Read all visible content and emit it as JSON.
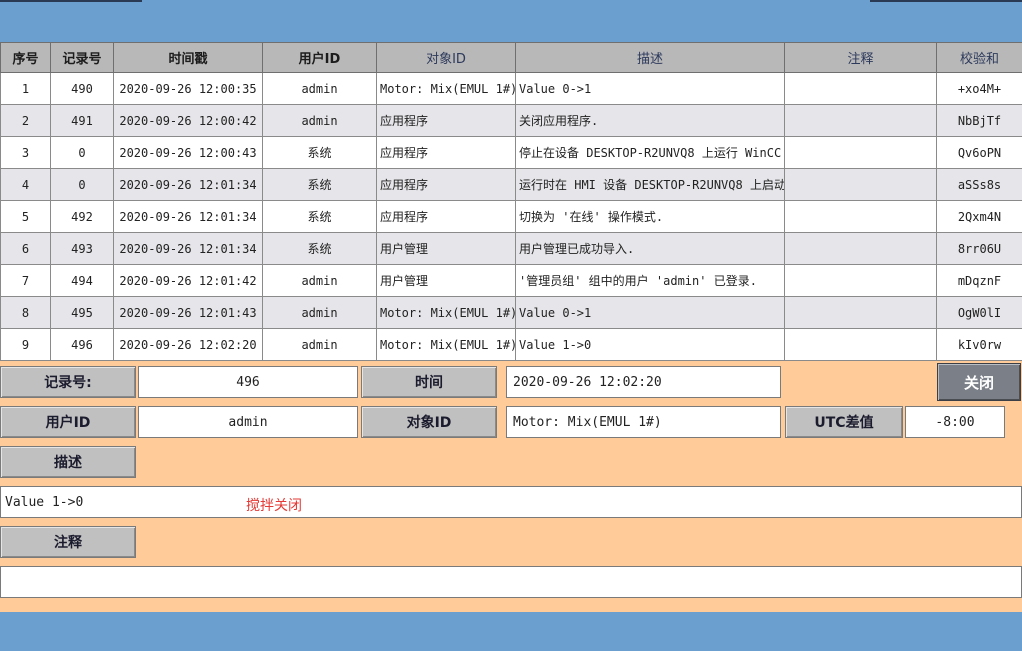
{
  "table": {
    "headers": [
      "序号",
      "记录号",
      "时间戳",
      "用户ID",
      "对象ID",
      "描述",
      "注释",
      "校验和"
    ],
    "rows": [
      {
        "seq": "1",
        "record": "490",
        "timestamp": "2020-09-26 12:00:35",
        "user": "admin",
        "object": "Motor: Mix(EMUL 1#)",
        "desc": "Value 0->1",
        "note": "",
        "checksum": "+xo4M+"
      },
      {
        "seq": "2",
        "record": "491",
        "timestamp": "2020-09-26 12:00:42",
        "user": "admin",
        "object": "应用程序",
        "desc": "关闭应用程序.",
        "note": "",
        "checksum": "NbBjTf"
      },
      {
        "seq": "3",
        "record": "0",
        "timestamp": "2020-09-26 12:00:43",
        "user": "系统",
        "object": "应用程序",
        "desc": "停止在设备 DESKTOP-R2UNVQ8 上运行 WinCC",
        "note": "",
        "checksum": "Qv6oPN"
      },
      {
        "seq": "4",
        "record": "0",
        "timestamp": "2020-09-26 12:01:34",
        "user": "系统",
        "object": "应用程序",
        "desc": "运行时在 HMI 设备 DESKTOP-R2UNVQ8 上启动",
        "note": "",
        "checksum": "aSSs8s"
      },
      {
        "seq": "5",
        "record": "492",
        "timestamp": "2020-09-26 12:01:34",
        "user": "系统",
        "object": "应用程序",
        "desc": "切换为 '在线' 操作模式.",
        "note": "",
        "checksum": "2Qxm4N"
      },
      {
        "seq": "6",
        "record": "493",
        "timestamp": "2020-09-26 12:01:34",
        "user": "系统",
        "object": "用户管理",
        "desc": "用户管理已成功导入.",
        "note": "",
        "checksum": "8rr06U"
      },
      {
        "seq": "7",
        "record": "494",
        "timestamp": "2020-09-26 12:01:42",
        "user": "admin",
        "object": "用户管理",
        "desc": "'管理员组' 组中的用户 'admin' 已登录.",
        "note": "",
        "checksum": "mDqznF"
      },
      {
        "seq": "8",
        "record": "495",
        "timestamp": "2020-09-26 12:01:43",
        "user": "admin",
        "object": "Motor: Mix(EMUL 1#)",
        "desc": "Value 0->1",
        "note": "",
        "checksum": "OgW0lI"
      },
      {
        "seq": "9",
        "record": "496",
        "timestamp": "2020-09-26 12:02:20",
        "user": "admin",
        "object": "Motor: Mix(EMUL 1#)",
        "desc": "Value 1->0",
        "note": "",
        "checksum": "kIv0rw"
      }
    ]
  },
  "detail": {
    "record_label": "记录号:",
    "record_value": "496",
    "time_label": "时间",
    "time_value": "2020-09-26 12:02:20",
    "close_label": "关闭",
    "user_label": "用户ID",
    "user_value": "admin",
    "object_label": "对象ID",
    "object_value": "Motor: Mix(EMUL 1#)",
    "utc_label": "UTC差值",
    "utc_value": "-8:00",
    "desc_label": "描述",
    "desc_value": "Value 1->0",
    "annotation": "搅拌关闭",
    "note_label": "注释",
    "note_value": ""
  },
  "colors": {
    "panel_bg": "#ffcc99",
    "bar_blue": "#6a9fd0",
    "annotation_red": "#e53935",
    "close_button": "#7a7f88"
  }
}
